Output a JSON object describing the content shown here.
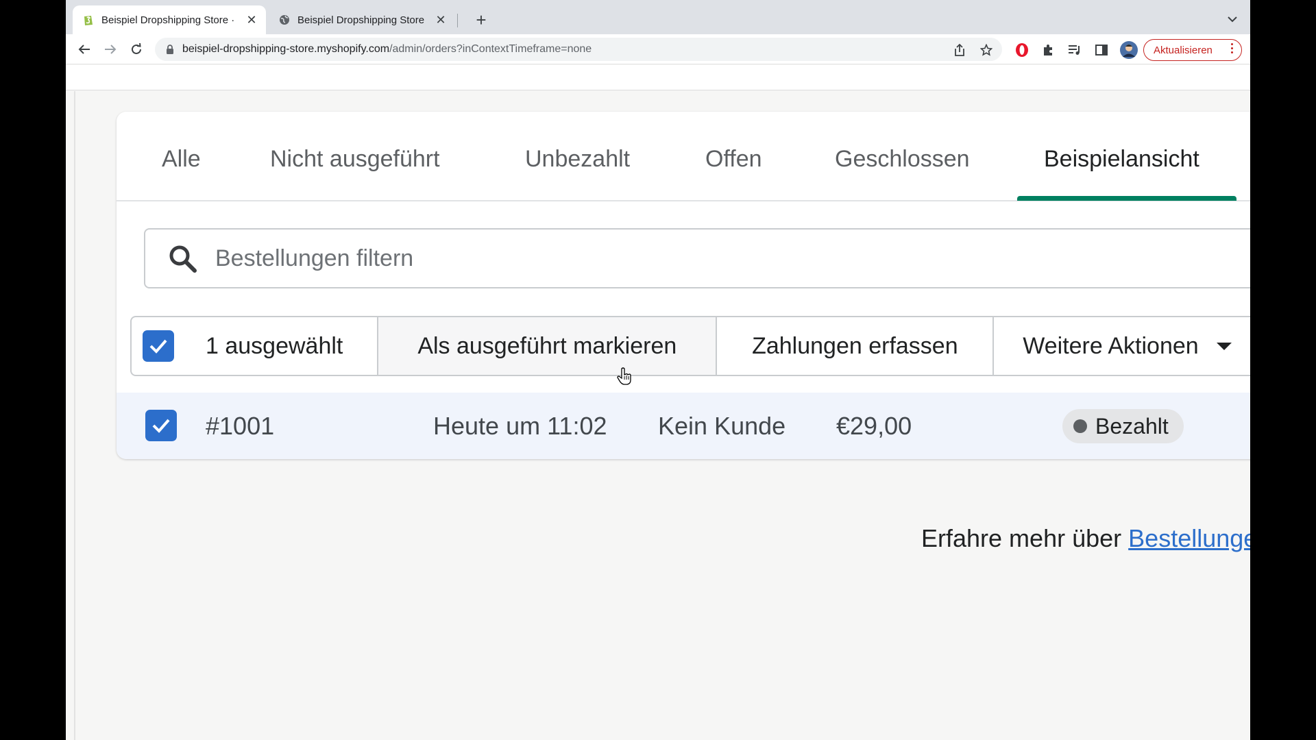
{
  "browser": {
    "tabs": [
      {
        "title": "Beispiel Dropshipping Store · E",
        "active": true,
        "icon": "shopify-icon"
      },
      {
        "title": "Beispiel Dropshipping Store",
        "active": false,
        "icon": "globe-icon"
      }
    ],
    "url_host": "beispiel-dropshipping-store.myshopify.com",
    "url_path": "/admin/orders?inContextTimeframe=none",
    "update_label": "Aktualisieren"
  },
  "orders": {
    "views": [
      "Alle",
      "Nicht ausgeführt",
      "Unbezahlt",
      "Offen",
      "Geschlossen",
      "Beispielansicht"
    ],
    "selected_view": "Beispielansicht",
    "search_placeholder": "Bestellungen filtern",
    "bulk": {
      "selected_count_label": "1 ausgewählt",
      "mark_fulfilled": "Als ausgeführt markieren",
      "capture_payments": "Zahlungen erfassen",
      "more_actions": "Weitere Aktionen"
    },
    "rows": [
      {
        "order": "#1001",
        "date": "Heute um 11:02",
        "customer": "Kein Kunde",
        "total": "€29,00",
        "payment_status": "Bezahlt",
        "checked": true
      }
    ],
    "learn_more_prefix": "Erfahre mehr über",
    "learn_more_link": "Bestellungen"
  },
  "colors": {
    "accent_green": "#008060",
    "checkbox_blue": "#2c6ecb",
    "update_red": "#c5221f"
  }
}
